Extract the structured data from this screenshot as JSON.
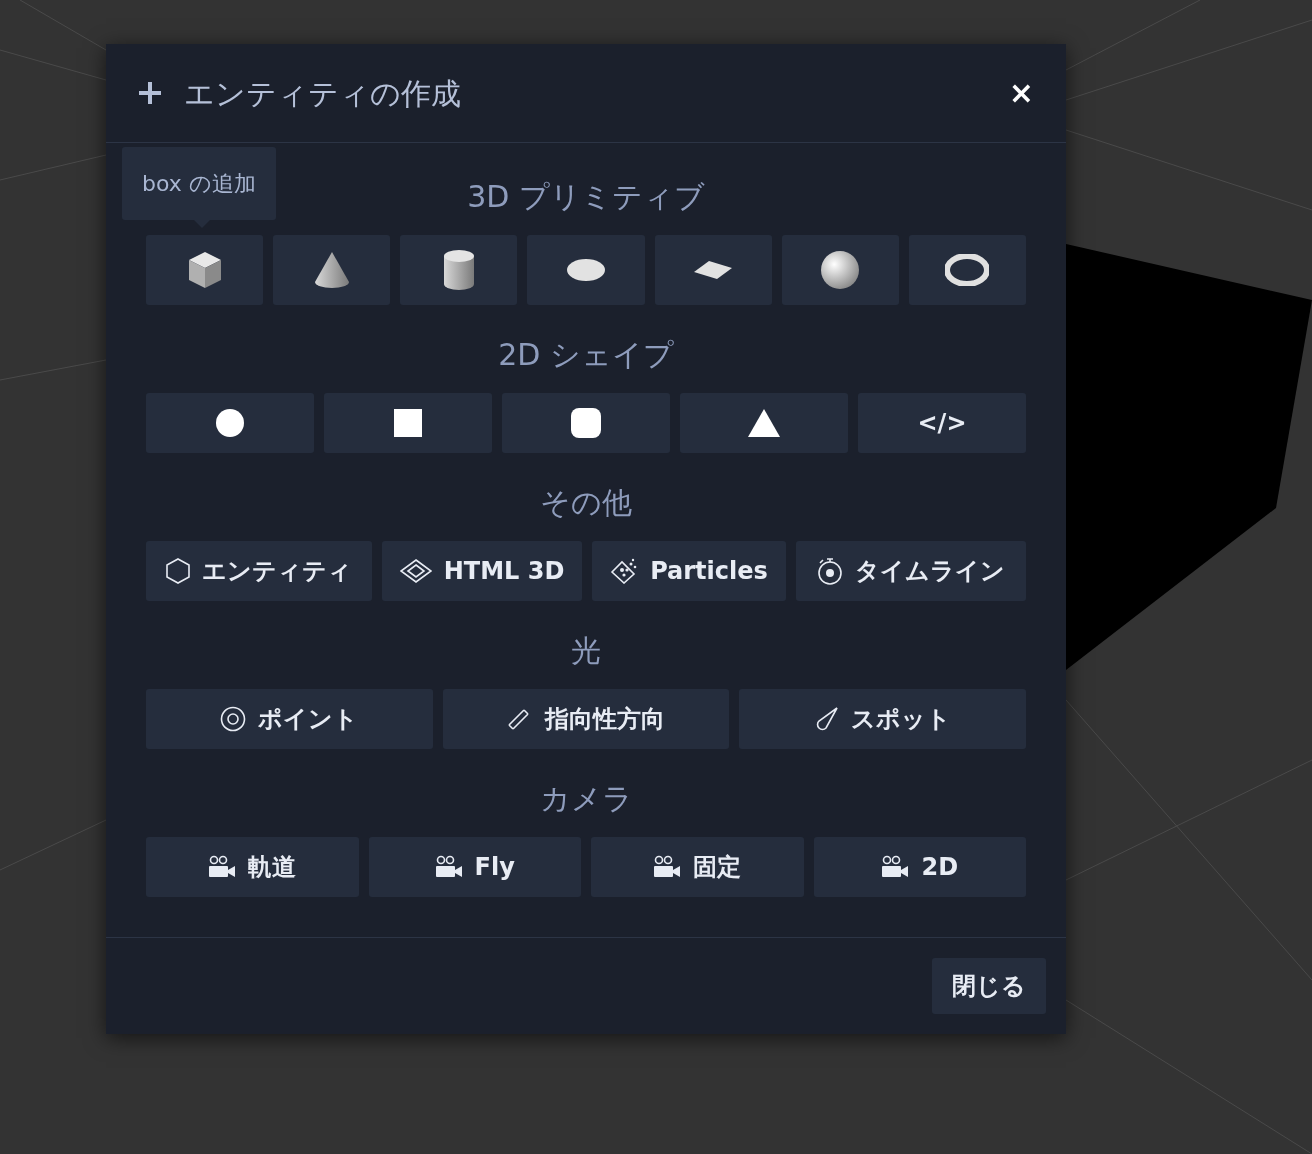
{
  "dialog": {
    "title": "エンティティの作成",
    "close_icon": "×"
  },
  "tooltip": {
    "text": "box の追加"
  },
  "sections": [
    {
      "kind": "primitives",
      "heading": "3D プリミティブ",
      "items": [
        {
          "kind": "box"
        },
        {
          "kind": "cone"
        },
        {
          "kind": "cylinder"
        },
        {
          "kind": "circle3d"
        },
        {
          "kind": "plane"
        },
        {
          "kind": "sphere"
        },
        {
          "kind": "torus"
        }
      ]
    },
    {
      "kind": "shapes",
      "heading": "2D シェイプ",
      "items": [
        {
          "kind": "circle"
        },
        {
          "kind": "square"
        },
        {
          "kind": "rounded"
        },
        {
          "kind": "triangle"
        },
        {
          "kind": "html",
          "label": "</>"
        }
      ]
    },
    {
      "kind": "other",
      "heading": "その他",
      "items": [
        {
          "kind": "hexagon",
          "label": "エンティティ"
        },
        {
          "kind": "diamond",
          "label": "HTML 3D"
        },
        {
          "kind": "particles",
          "label": "Particles"
        },
        {
          "kind": "timer",
          "label": "タイムライン"
        }
      ]
    },
    {
      "kind": "lights",
      "heading": "光",
      "items": [
        {
          "kind": "point",
          "label": "ポイント"
        },
        {
          "kind": "directional",
          "label": "指向性方向"
        },
        {
          "kind": "spot",
          "label": "スポット"
        }
      ]
    },
    {
      "kind": "cameras",
      "heading": "カメラ",
      "items": [
        {
          "kind": "camera",
          "label": "軌道"
        },
        {
          "kind": "camera",
          "label": "Fly"
        },
        {
          "kind": "camera",
          "label": "固定"
        },
        {
          "kind": "camera",
          "label": "2D"
        }
      ]
    }
  ],
  "footer": {
    "close_button": "閉じる"
  }
}
